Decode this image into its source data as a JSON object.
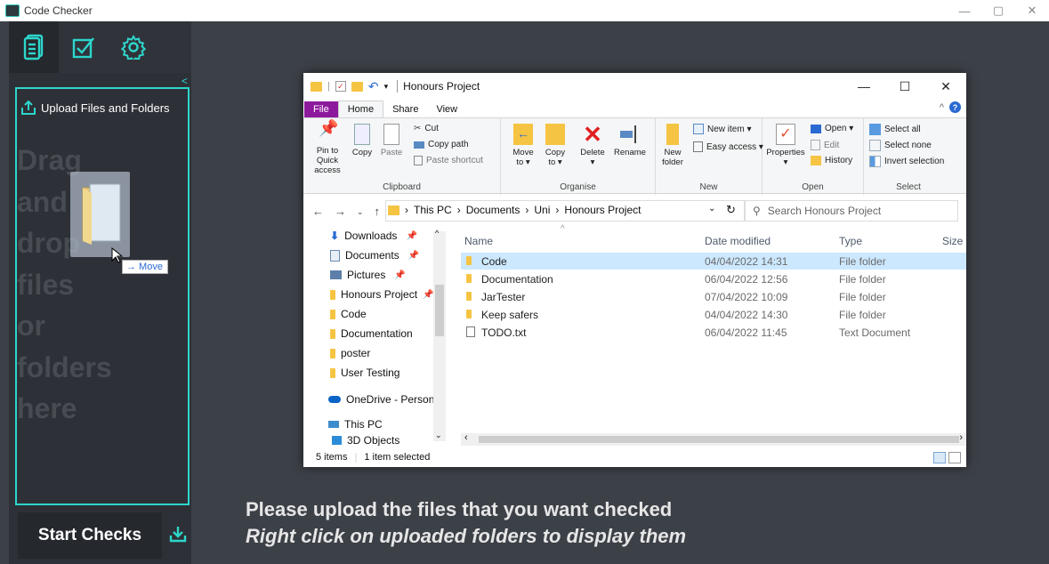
{
  "window": {
    "title": "Code Checker",
    "controls": [
      "—",
      "▢",
      "✕"
    ]
  },
  "sidebar": {
    "nav": [
      {
        "icon": "document-icon"
      },
      {
        "icon": "checkbox-icon"
      },
      {
        "icon": "gear-icon"
      }
    ],
    "collapse": "<",
    "upload_label": "Upload Files and Folders",
    "drag_text": [
      "Drag",
      "and",
      "drop",
      "files",
      "or",
      "folders",
      "here"
    ],
    "move_tip": "→ Move",
    "start_label": "Start Checks",
    "accent": "#2dd6cc"
  },
  "explorer": {
    "title": "Honours Project",
    "tabs": [
      "File",
      "Home",
      "Share",
      "View"
    ],
    "ribbon": {
      "clipboard": {
        "label": "Clipboard",
        "pin": "Pin to Quick access",
        "copy": "Copy",
        "paste": "Paste",
        "cut": "Cut",
        "copy_path": "Copy path",
        "paste_shortcut": "Paste shortcut"
      },
      "organise": {
        "label": "Organise",
        "move_to": "Move to ▾",
        "copy_to": "Copy to ▾",
        "delete": "Delete ▾",
        "rename": "Rename"
      },
      "new": {
        "label": "New",
        "new_folder": "New folder",
        "new_item": "New item ▾",
        "easy_access": "Easy access ▾"
      },
      "open": {
        "label": "Open",
        "properties": "Properties ▾",
        "open": "Open ▾",
        "edit": "Edit",
        "history": "History"
      },
      "select": {
        "label": "Select",
        "select_all": "Select all",
        "select_none": "Select none",
        "invert": "Invert selection"
      }
    },
    "breadcrumb": [
      "This PC",
      "Documents",
      "Uni",
      "Honours Project"
    ],
    "search_placeholder": "Search Honours Project",
    "nav_pane": [
      {
        "label": "Downloads",
        "pinned": true,
        "icon": "download-icon"
      },
      {
        "label": "Documents",
        "pinned": true,
        "icon": "documents-icon"
      },
      {
        "label": "Pictures",
        "pinned": true,
        "icon": "pictures-icon"
      },
      {
        "label": "Honours Project",
        "pinned": true,
        "icon": "folder-icon"
      },
      {
        "label": "Code",
        "pinned": false,
        "icon": "folder-icon"
      },
      {
        "label": "Documentation",
        "pinned": false,
        "icon": "folder-icon"
      },
      {
        "label": "poster",
        "pinned": false,
        "icon": "folder-icon"
      },
      {
        "label": "User Testing",
        "pinned": false,
        "icon": "folder-icon"
      },
      {
        "label": "OneDrive - Personal",
        "pinned": false,
        "icon": "cloud-icon"
      },
      {
        "label": "This PC",
        "pinned": false,
        "icon": "pc-icon"
      },
      {
        "label": "3D Objects",
        "pinned": false,
        "icon": "cube-icon"
      }
    ],
    "columns": [
      "Name",
      "Date modified",
      "Type",
      "Size"
    ],
    "files": [
      {
        "name": "Code",
        "date": "04/04/2022 14:31",
        "type": "File folder",
        "selected": true,
        "kind": "folder"
      },
      {
        "name": "Documentation",
        "date": "06/04/2022 12:56",
        "type": "File folder",
        "selected": false,
        "kind": "folder"
      },
      {
        "name": "JarTester",
        "date": "07/04/2022 10:09",
        "type": "File folder",
        "selected": false,
        "kind": "folder"
      },
      {
        "name": "Keep safers",
        "date": "04/04/2022 14:30",
        "type": "File folder",
        "selected": false,
        "kind": "folder"
      },
      {
        "name": "TODO.txt",
        "date": "06/04/2022 11:45",
        "type": "Text Document",
        "selected": false,
        "kind": "text"
      }
    ],
    "status": {
      "items": "5 items",
      "selected": "1 item selected"
    }
  },
  "message": {
    "line1": "Please upload the files that you want checked",
    "line2": "Right click on uploaded folders to display them"
  }
}
